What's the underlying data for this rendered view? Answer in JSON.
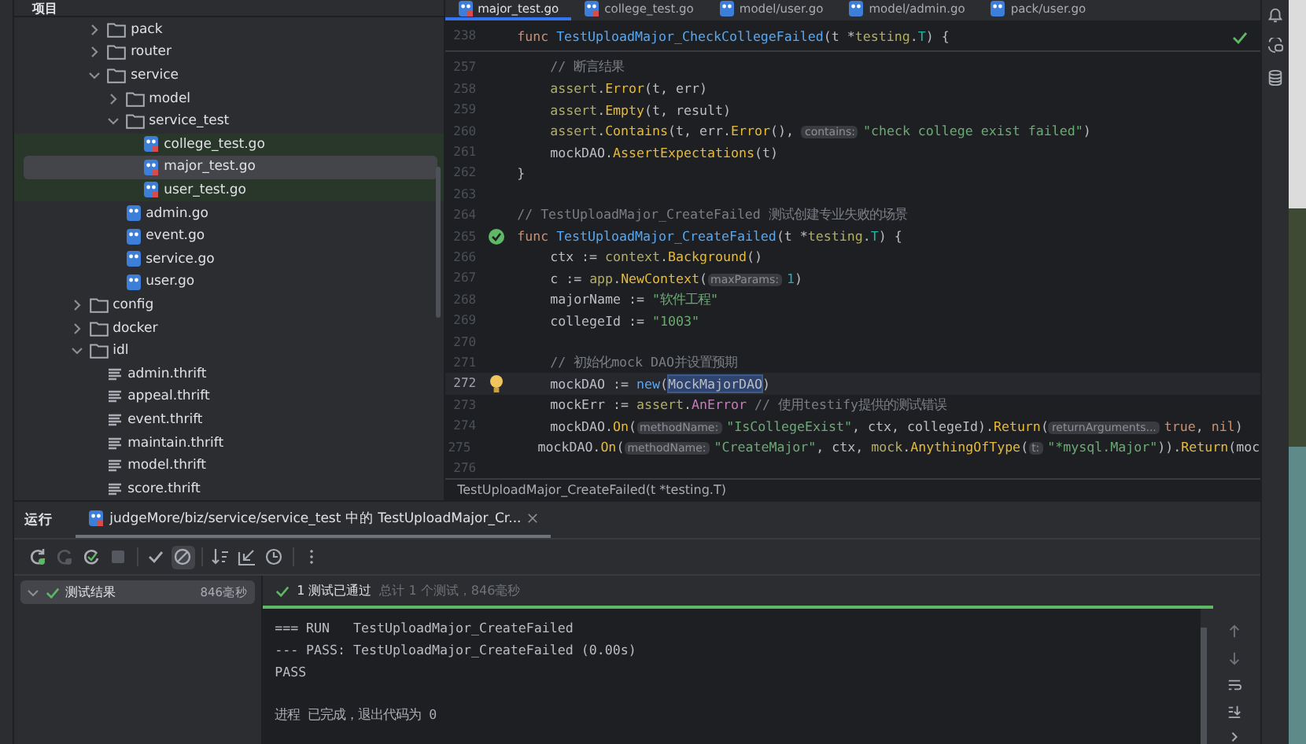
{
  "project_panel": {
    "title": "项目",
    "items": [
      {
        "children": [
          {
            "name": "pack",
            "kind": "folder",
            "expanded": false,
            "selected": false
          },
          {
            "name": "router",
            "kind": "folder",
            "expanded": false,
            "selected": false
          },
          {
            "name": "service",
            "kind": "folder",
            "expanded": true,
            "selected": false,
            "children": [
              {
                "name": "model",
                "kind": "folder",
                "expanded": false,
                "selected": false
              },
              {
                "name": "service_test",
                "kind": "folder",
                "expanded": true,
                "selected": false,
                "children": [
                  {
                    "name": "college_test.go",
                    "kind": "gotest",
                    "selected": false
                  },
                  {
                    "name": "major_test.go",
                    "kind": "gotest",
                    "selected": true
                  },
                  {
                    "name": "user_test.go",
                    "kind": "gotest",
                    "selected": false
                  }
                ]
              },
              {
                "name": "admin.go",
                "kind": "go",
                "selected": false
              },
              {
                "name": "event.go",
                "kind": "go",
                "selected": false
              },
              {
                "name": "service.go",
                "kind": "go",
                "selected": false
              },
              {
                "name": "user.go",
                "kind": "go",
                "selected": false
              }
            ]
          }
        ]
      },
      {
        "name": "config",
        "kind": "folder",
        "expanded": false,
        "selected": false
      },
      {
        "name": "docker",
        "kind": "folder",
        "expanded": false,
        "selected": false
      },
      {
        "name": "idl",
        "kind": "folder",
        "expanded": true,
        "selected": false,
        "children": [
          {
            "name": "admin.thrift",
            "kind": "thrift",
            "selected": false
          },
          {
            "name": "appeal.thrift",
            "kind": "thrift",
            "selected": false
          },
          {
            "name": "event.thrift",
            "kind": "thrift",
            "selected": false
          },
          {
            "name": "maintain.thrift",
            "kind": "thrift",
            "selected": false
          },
          {
            "name": "model.thrift",
            "kind": "thrift",
            "selected": false
          },
          {
            "name": "score.thrift",
            "kind": "thrift",
            "selected": false
          }
        ]
      }
    ]
  },
  "editor": {
    "tabs": [
      {
        "label": "major_test.go",
        "selected": true
      },
      {
        "label": "college_test.go",
        "selected": false
      },
      {
        "label": "model/user.go",
        "selected": false
      },
      {
        "label": "model/admin.go",
        "selected": false
      },
      {
        "label": "pack/user.go",
        "selected": false
      }
    ],
    "sticky_line": {
      "number": "238",
      "indented": false,
      "tokens": [
        {
          "kind": "kw",
          "text": "func "
        },
        {
          "kind": "fn",
          "text": "TestUploadMajor_CheckCollegeFailed"
        },
        {
          "kind": "plain",
          "text": "(t *"
        },
        {
          "kind": "pkg",
          "text": "testing"
        },
        {
          "kind": "plain",
          "text": "."
        },
        {
          "kind": "type",
          "text": "T"
        },
        {
          "kind": "plain",
          "text": ") {"
        }
      ]
    },
    "lines": [
      {
        "number": "257",
        "current": false,
        "indented": true,
        "tokens": [
          {
            "kind": "comment",
            "text": "// 断言结果"
          }
        ]
      },
      {
        "number": "258",
        "current": false,
        "indented": true,
        "tokens": [
          {
            "kind": "pkg",
            "text": "assert"
          },
          {
            "kind": "plain",
            "text": "."
          },
          {
            "kind": "method",
            "text": "Error"
          },
          {
            "kind": "plain",
            "text": "(t, err)"
          }
        ]
      },
      {
        "number": "259",
        "current": false,
        "indented": true,
        "tokens": [
          {
            "kind": "pkg",
            "text": "assert"
          },
          {
            "kind": "plain",
            "text": "."
          },
          {
            "kind": "method",
            "text": "Empty"
          },
          {
            "kind": "plain",
            "text": "(t, result)"
          }
        ]
      },
      {
        "number": "260",
        "current": false,
        "indented": true,
        "tokens": [
          {
            "kind": "pkg",
            "text": "assert"
          },
          {
            "kind": "plain",
            "text": "."
          },
          {
            "kind": "method",
            "text": "Contains"
          },
          {
            "kind": "plain",
            "text": "(t, err."
          },
          {
            "kind": "method",
            "text": "Error"
          },
          {
            "kind": "plain",
            "text": "(), "
          },
          {
            "kind": "hint",
            "text": "contains:"
          },
          {
            "kind": "string",
            "text": "\"check college exist failed\""
          },
          {
            "kind": "plain",
            "text": ")"
          }
        ]
      },
      {
        "number": "261",
        "current": false,
        "indented": true,
        "tokens": [
          {
            "kind": "plain",
            "text": "mockDAO."
          },
          {
            "kind": "method",
            "text": "AssertExpectations"
          },
          {
            "kind": "plain",
            "text": "(t)"
          }
        ]
      },
      {
        "number": "262",
        "current": false,
        "indented": false,
        "tokens": [
          {
            "kind": "plain",
            "text": "}"
          }
        ]
      },
      {
        "number": "263",
        "current": false
      },
      {
        "number": "264",
        "current": false,
        "indented": false,
        "tokens": [
          {
            "kind": "comment",
            "text": "// TestUploadMajor_CreateFailed 测试创建专业失败的场景"
          }
        ]
      },
      {
        "number": "265",
        "current": false,
        "indented": false,
        "gutter": {
          "kind": "test-passed"
        },
        "tokens": [
          {
            "kind": "kw",
            "text": "func "
          },
          {
            "kind": "fn",
            "text": "TestUploadMajor_CreateFailed"
          },
          {
            "kind": "plain",
            "text": "(t *"
          },
          {
            "kind": "pkg",
            "text": "testing"
          },
          {
            "kind": "plain",
            "text": "."
          },
          {
            "kind": "type",
            "text": "T"
          },
          {
            "kind": "plain",
            "text": ") {"
          }
        ]
      },
      {
        "number": "266",
        "current": false,
        "indented": true,
        "tokens": [
          {
            "kind": "plain",
            "text": "ctx := "
          },
          {
            "kind": "pkg",
            "text": "context"
          },
          {
            "kind": "plain",
            "text": "."
          },
          {
            "kind": "method",
            "text": "Background"
          },
          {
            "kind": "plain",
            "text": "()"
          }
        ]
      },
      {
        "number": "267",
        "current": false,
        "indented": true,
        "tokens": [
          {
            "kind": "plain",
            "text": "c := "
          },
          {
            "kind": "pkg",
            "text": "app"
          },
          {
            "kind": "plain",
            "text": "."
          },
          {
            "kind": "method",
            "text": "NewContext"
          },
          {
            "kind": "plain",
            "text": "("
          },
          {
            "kind": "hint",
            "text": "maxParams:"
          },
          {
            "kind": "number",
            "text": "1"
          },
          {
            "kind": "plain",
            "text": ")"
          }
        ]
      },
      {
        "number": "268",
        "current": false,
        "indented": true,
        "tokens": [
          {
            "kind": "plain",
            "text": "majorName := "
          },
          {
            "kind": "string",
            "text": "\"软件工程\""
          }
        ]
      },
      {
        "number": "269",
        "current": false,
        "indented": true,
        "tokens": [
          {
            "kind": "plain",
            "text": "collegeId := "
          },
          {
            "kind": "string",
            "text": "\"1003\""
          }
        ]
      },
      {
        "number": "270",
        "current": false
      },
      {
        "number": "271",
        "current": false,
        "indented": true,
        "tokens": [
          {
            "kind": "comment",
            "text": "// 初始化mock DAO并设置预期"
          }
        ]
      },
      {
        "number": "272",
        "current": true,
        "indented": true,
        "gutter": {
          "kind": "bulb"
        },
        "tokens": [
          {
            "kind": "plain",
            "text": "mockDAO := "
          },
          {
            "kind": "fn",
            "text": "new"
          },
          {
            "kind": "plain",
            "text": "("
          },
          {
            "kind": "usage",
            "text": "MockMajorDAO"
          },
          {
            "kind": "plain",
            "text": ")"
          }
        ]
      },
      {
        "number": "273",
        "current": false,
        "indented": true,
        "tokens": [
          {
            "kind": "plain",
            "text": "mockErr := "
          },
          {
            "kind": "pkg",
            "text": "assert"
          },
          {
            "kind": "plain",
            "text": "."
          },
          {
            "kind": "field",
            "text": "AnError "
          },
          {
            "kind": "comment",
            "text": "// 使用testify提供的测试错误"
          }
        ]
      },
      {
        "number": "274",
        "current": false,
        "indented": true,
        "tokens": [
          {
            "kind": "plain",
            "text": "mockDAO."
          },
          {
            "kind": "method",
            "text": "On"
          },
          {
            "kind": "plain",
            "text": "("
          },
          {
            "kind": "hint",
            "text": "methodName:"
          },
          {
            "kind": "string",
            "text": "\"IsCollegeExist\""
          },
          {
            "kind": "plain",
            "text": ", ctx, collegeId)."
          },
          {
            "kind": "method",
            "text": "Return"
          },
          {
            "kind": "plain",
            "text": "("
          },
          {
            "kind": "hint",
            "text": "returnArguments..."
          },
          {
            "kind": "kw",
            "text": "true"
          },
          {
            "kind": "plain",
            "text": ", "
          },
          {
            "kind": "kw",
            "text": "nil"
          },
          {
            "kind": "plain",
            "text": ")"
          }
        ]
      },
      {
        "number": "275",
        "current": false,
        "indented": true,
        "tokens": [
          {
            "kind": "plain",
            "text": "mockDAO."
          },
          {
            "kind": "method",
            "text": "On"
          },
          {
            "kind": "plain",
            "text": "("
          },
          {
            "kind": "hint",
            "text": "methodName:"
          },
          {
            "kind": "string",
            "text": "\"CreateMajor\""
          },
          {
            "kind": "plain",
            "text": ", ctx, "
          },
          {
            "kind": "pkg",
            "text": "mock"
          },
          {
            "kind": "plain",
            "text": "."
          },
          {
            "kind": "method",
            "text": "AnythingOfType"
          },
          {
            "kind": "plain",
            "text": "("
          },
          {
            "kind": "hint",
            "text": "t:"
          },
          {
            "kind": "string",
            "text": "\"*mysql.Major\""
          },
          {
            "kind": "plain",
            "text": "))."
          },
          {
            "kind": "method",
            "text": "Return"
          },
          {
            "kind": "plain",
            "text": "(moc"
          }
        ]
      },
      {
        "number": "276",
        "current": false
      }
    ],
    "breadcrumb": "TestUploadMajor_CreateFailed(t *testing.T)"
  },
  "run_panel": {
    "title": "运行",
    "run_tab": "judgeMore/biz/service/service_test 中的 TestUploadMajor_Cr...",
    "toolbar": [
      {
        "kind": "rerun",
        "disabled": false,
        "selected": false
      },
      {
        "kind": "rerun-failed",
        "disabled": true,
        "selected": false
      },
      {
        "kind": "toggle-auto",
        "disabled": false,
        "selected": false
      },
      {
        "kind": "stop",
        "disabled": true,
        "selected": false
      },
      {
        "kind": "show-passed",
        "disabled": false,
        "selected": false
      },
      {
        "kind": "show-ignored",
        "disabled": false,
        "selected": true
      },
      {
        "kind": "sort",
        "disabled": false,
        "selected": false
      },
      {
        "kind": "import",
        "disabled": false,
        "selected": false
      },
      {
        "kind": "history",
        "disabled": false,
        "selected": false
      },
      {
        "kind": "more",
        "disabled": false,
        "selected": false
      }
    ],
    "results": [
      {
        "label": "测试结果",
        "time": "846毫秒",
        "selected": true,
        "passed": true
      }
    ],
    "status": {
      "label": "1 测试已通过",
      "summary": "总计 1 个测试，846毫秒",
      "level": 1
    },
    "console": [
      {
        "kind": "output",
        "text": "=== RUN   TestUploadMajor_CreateFailed"
      },
      {
        "kind": "output",
        "text": "--- PASS: TestUploadMajor_CreateFailed (0.00s)"
      },
      {
        "kind": "output",
        "text": "PASS"
      },
      {
        "kind": "exit",
        "text": "进程 已完成，退出代码为 0"
      }
    ]
  }
}
